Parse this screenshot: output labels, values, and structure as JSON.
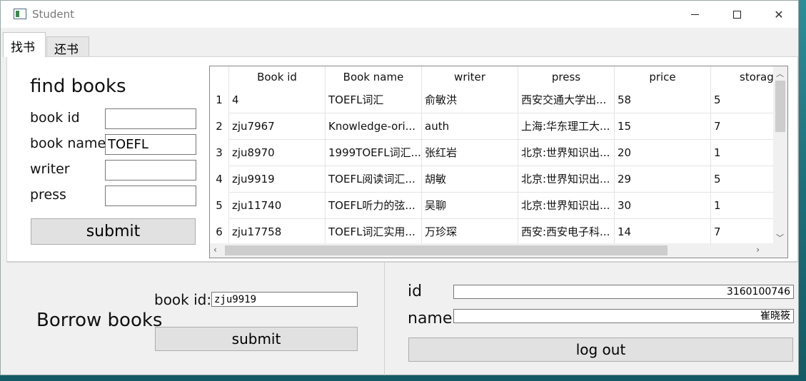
{
  "window": {
    "title": "Student"
  },
  "tabs": [
    {
      "label": "找书",
      "active": true
    },
    {
      "label": "还书",
      "active": false
    }
  ],
  "find": {
    "title": "find books",
    "fields": [
      {
        "label": "book id",
        "value": ""
      },
      {
        "label": "book name",
        "value": "TOEFL"
      },
      {
        "label": "writer",
        "value": ""
      },
      {
        "label": "press",
        "value": ""
      }
    ],
    "submit_label": "submit"
  },
  "table": {
    "columns": [
      "Book id",
      "Book name",
      "writer",
      "press",
      "price",
      "storag"
    ],
    "rows": [
      {
        "n": "1",
        "cells": [
          "4",
          "TOEFL词汇",
          "俞敏洪",
          "西安交通大学出...",
          "58",
          "5"
        ]
      },
      {
        "n": "2",
        "cells": [
          "zju7967",
          "Knowledge-ori...",
          "auth",
          "上海:华东理工大...",
          "15",
          "7"
        ]
      },
      {
        "n": "3",
        "cells": [
          "zju8970",
          "1999TOEFL词汇...",
          "张红岩",
          "北京:世界知识出...",
          "20",
          "1"
        ]
      },
      {
        "n": "4",
        "cells": [
          "zju9919",
          "TOEFL阅读词汇...",
          "胡敏",
          "北京:世界知识出...",
          "29",
          "5"
        ]
      },
      {
        "n": "5",
        "cells": [
          "zju11740",
          "TOEFL听力的弦...",
          "吴聊",
          "北京:世界知识出...",
          "30",
          "1"
        ]
      },
      {
        "n": "6",
        "cells": [
          "zju17758",
          "TOEFL词汇实用...",
          "万珍琛",
          "西安:西安电子科...",
          "14",
          "7"
        ]
      }
    ]
  },
  "borrow": {
    "title": "Borrow books",
    "book_id_label": "book id:",
    "book_id_value": "zju9919",
    "submit_label": "submit"
  },
  "user": {
    "id_label": "id",
    "id_value": "3160100746",
    "name_label": "name",
    "name_value": "崔晓筱",
    "logout_label": "log out"
  },
  "colors": {
    "accent_bg": "#f0f0f0",
    "button": "#e1e1e1",
    "desktop": "#1f7f8a"
  }
}
